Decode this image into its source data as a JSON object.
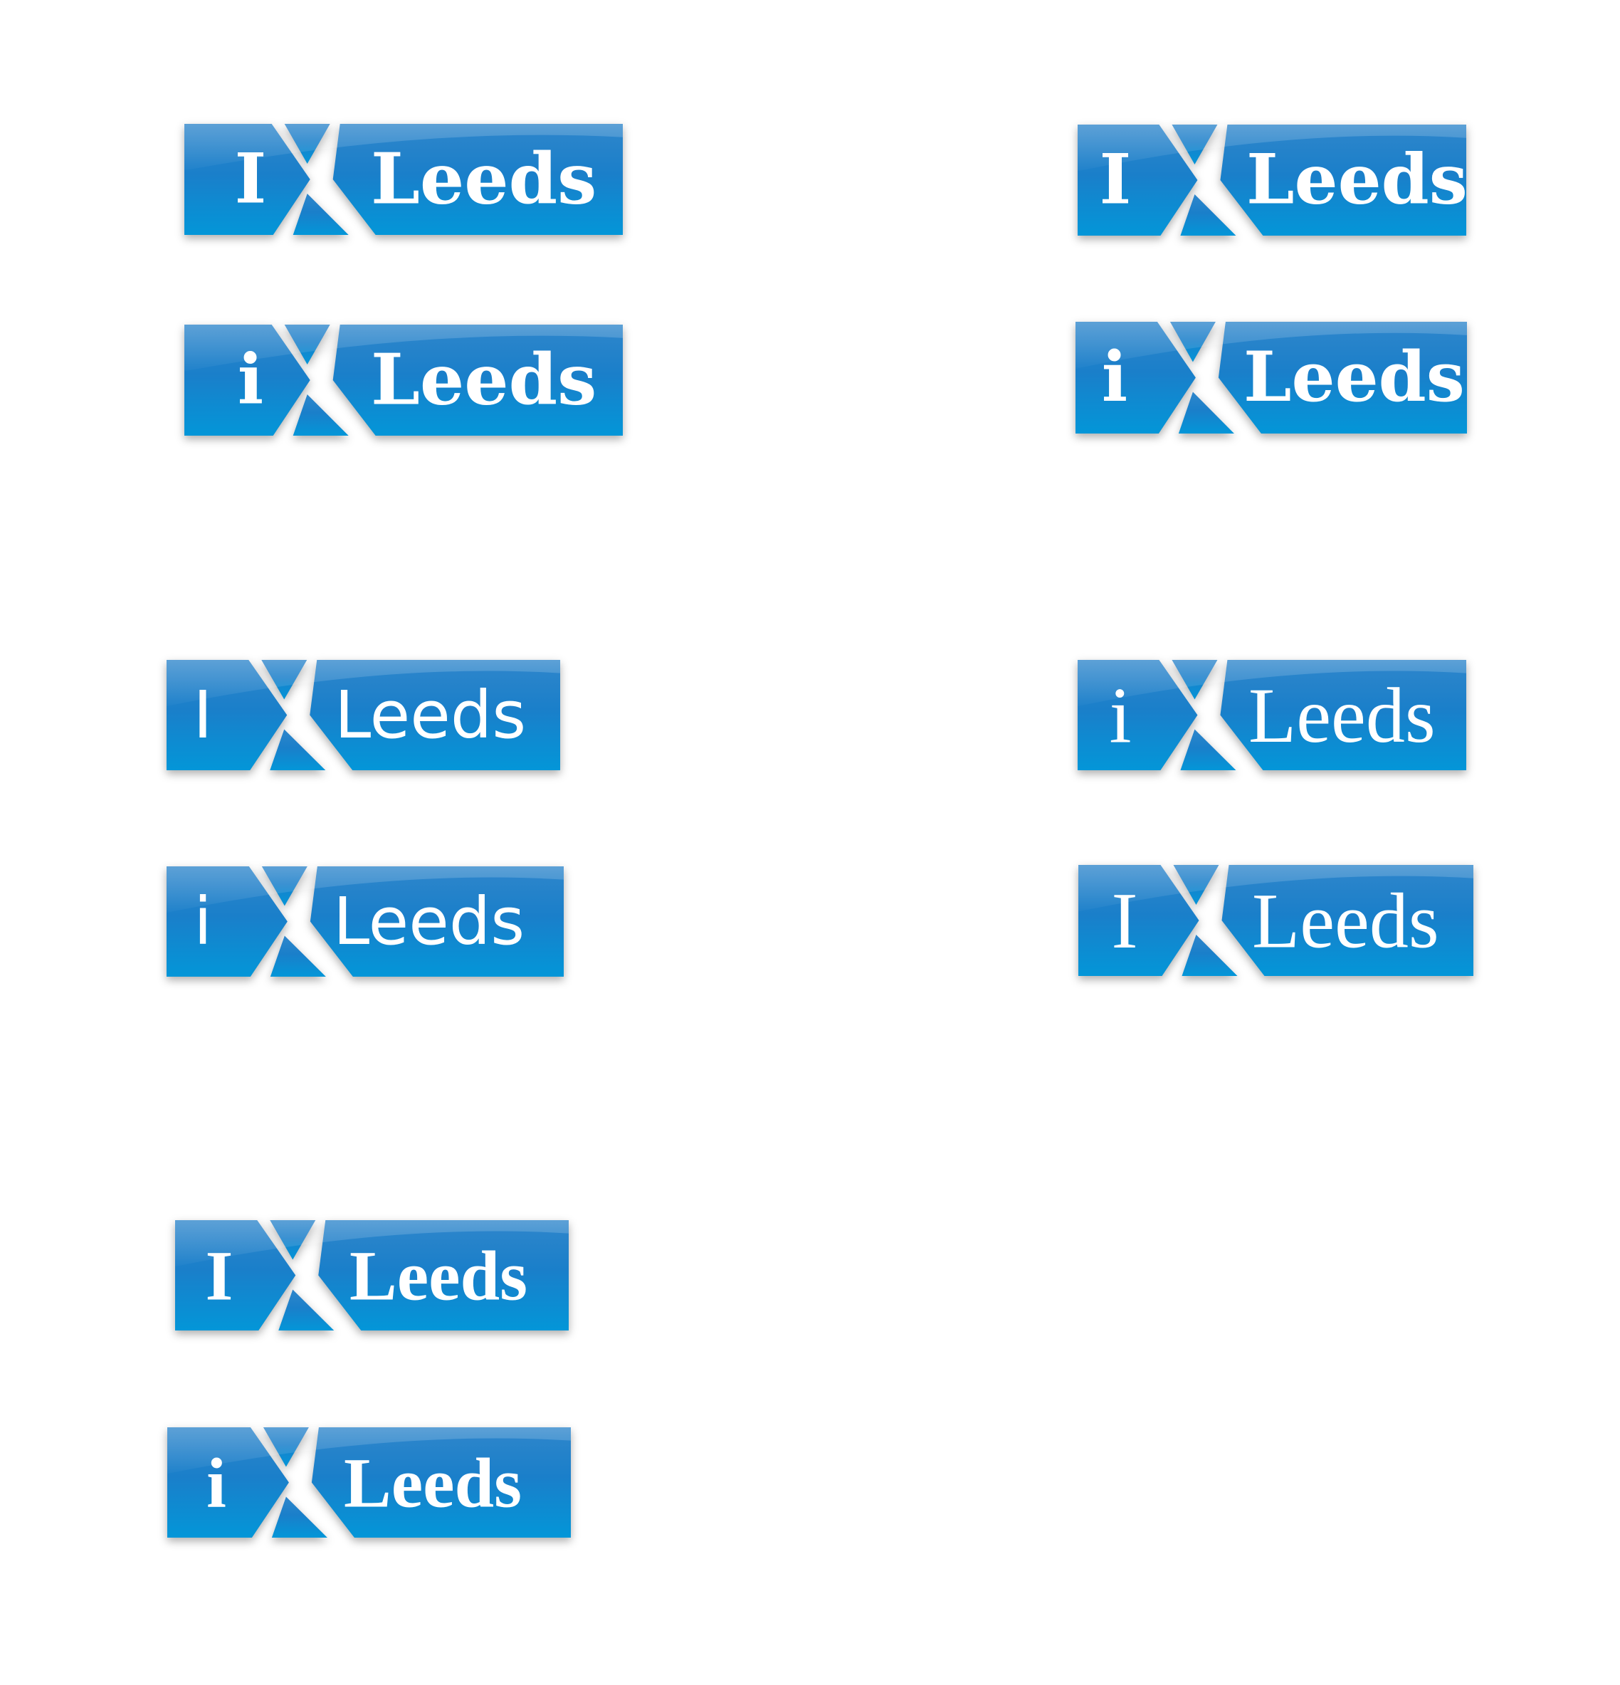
{
  "logos": [
    {
      "letter": "I",
      "word": "Leeds"
    },
    {
      "letter": "i",
      "word": "Leeds"
    },
    {
      "letter": "I",
      "word": "Leeds"
    },
    {
      "letter": "i",
      "word": "Leeds"
    },
    {
      "letter": "I",
      "word": "Leeds"
    },
    {
      "letter": "i",
      "word": "Leeds"
    },
    {
      "letter": "i",
      "word": "Leeds"
    },
    {
      "letter": "I",
      "word": "Leeds"
    },
    {
      "letter": "I",
      "word": "Leeds"
    },
    {
      "letter": "i",
      "word": "Leeds"
    }
  ],
  "colors": {
    "badge_top": "#2f86cb",
    "badge_mid": "#1a7fca",
    "badge_bottom": "#0396d8",
    "text": "#ffffff",
    "background": "#ffffff"
  }
}
